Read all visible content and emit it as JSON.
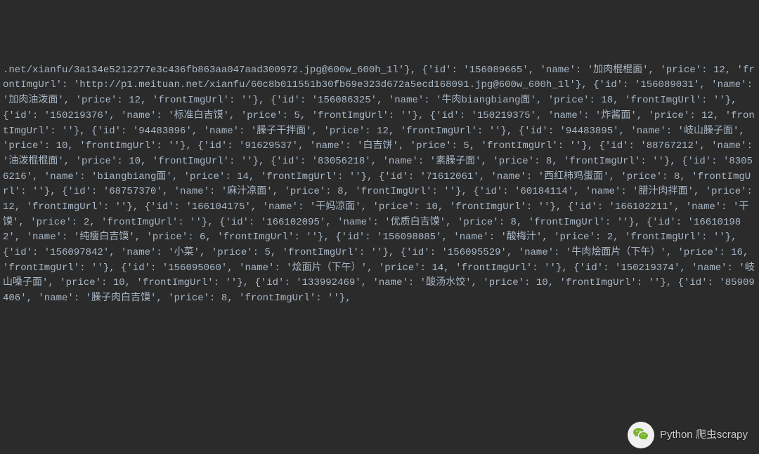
{
  "watermark": {
    "text": "Python 爬虫scrapy"
  },
  "console_text": ".net/xianfu/3a134e5212277e3c436fb863aa047aad300972.jpg@600w_600h_1l'}, {'id': '156089665', 'name': '加肉棍棍面', 'price': 12, 'frontImgUrl': 'http://p1.meituan.net/xianfu/60c8b011551b30fb69e323d672a5ecd168091.jpg@600w_600h_1l'}, {'id': '156089031', 'name': '加肉油泼面', 'price': 12, 'frontImgUrl': ''}, {'id': '156086325', 'name': '牛肉biangbiang面', 'price': 18, 'frontImgUrl': ''}, {'id': '150219376', 'name': '标准白吉馍', 'price': 5, 'frontImgUrl': ''}, {'id': '150219375', 'name': '炸酱面', 'price': 12, 'frontImgUrl': ''}, {'id': '94483896', 'name': '臊子干拌面', 'price': 12, 'frontImgUrl': ''}, {'id': '94483895', 'name': '岐山臊子面', 'price': 10, 'frontImgUrl': ''}, {'id': '91629537', 'name': '白吉饼', 'price': 5, 'frontImgUrl': ''}, {'id': '88767212', 'name': '油泼棍棍面', 'price': 10, 'frontImgUrl': ''}, {'id': '83056218', 'name': '素臊子面', 'price': 8, 'frontImgUrl': ''}, {'id': '83056216', 'name': 'biangbiang面', 'price': 14, 'frontImgUrl': ''}, {'id': '71612061', 'name': '西红柿鸡蛋面', 'price': 8, 'frontImgUrl': ''}, {'id': '68757370', 'name': '麻汁凉面', 'price': 8, 'frontImgUrl': ''}, {'id': '60184114', 'name': '腊汁肉拌面', 'price': 12, 'frontImgUrl': ''}, {'id': '166104175', 'name': '干妈凉面', 'price': 10, 'frontImgUrl': ''}, {'id': '166102211', 'name': '干馍', 'price': 2, 'frontImgUrl': ''}, {'id': '166102095', 'name': '优质白吉馍', 'price': 8, 'frontImgUrl': ''}, {'id': '166101982', 'name': '纯瘦白吉馍', 'price': 6, 'frontImgUrl': ''}, {'id': '156098085', 'name': '酸梅汁', 'price': 2, 'frontImgUrl': ''}, {'id': '156097842', 'name': '小菜', 'price': 5, 'frontImgUrl': ''}, {'id': '156095529', 'name': '牛肉烩面片（下午）', 'price': 16, 'frontImgUrl': ''}, {'id': '156095060', 'name': '烩面片（下午）', 'price': 14, 'frontImgUrl': ''}, {'id': '150219374', 'name': '岐山嗓子面', 'price': 10, 'frontImgUrl': ''}, {'id': '133992469', 'name': '酸汤水饺', 'price': 10, 'frontImgUrl': ''}, {'id': '85909406', 'name': '臊子肉白吉馍', 'price': 8, 'frontImgUrl': ''},",
  "items": [
    {
      "id": "156089665",
      "name": "加肉棍棍面",
      "price": 12,
      "frontImgUrl": "http://p1.meituan.net/xianfu/60c8b011551b30fb69e323d672a5ecd168091.jpg@600w_600h_1l"
    },
    {
      "id": "156089031",
      "name": "加肉油泼面",
      "price": 12,
      "frontImgUrl": ""
    },
    {
      "id": "156086325",
      "name": "牛肉biangbiang面",
      "price": 18,
      "frontImgUrl": ""
    },
    {
      "id": "150219376",
      "name": "标准白吉馍",
      "price": 5,
      "frontImgUrl": ""
    },
    {
      "id": "150219375",
      "name": "炸酱面",
      "price": 12,
      "frontImgUrl": ""
    },
    {
      "id": "94483896",
      "name": "臊子干拌面",
      "price": 12,
      "frontImgUrl": ""
    },
    {
      "id": "94483895",
      "name": "岐山臊子面",
      "price": 10,
      "frontImgUrl": ""
    },
    {
      "id": "91629537",
      "name": "白吉饼",
      "price": 5,
      "frontImgUrl": ""
    },
    {
      "id": "88767212",
      "name": "油泼棍棍面",
      "price": 10,
      "frontImgUrl": ""
    },
    {
      "id": "83056218",
      "name": "素臊子面",
      "price": 8,
      "frontImgUrl": ""
    },
    {
      "id": "83056216",
      "name": "biangbiang面",
      "price": 14,
      "frontImgUrl": ""
    },
    {
      "id": "71612061",
      "name": "西红柿鸡蛋面",
      "price": 8,
      "frontImgUrl": ""
    },
    {
      "id": "68757370",
      "name": "麻汁凉面",
      "price": 8,
      "frontImgUrl": ""
    },
    {
      "id": "60184114",
      "name": "腊汁肉拌面",
      "price": 12,
      "frontImgUrl": ""
    },
    {
      "id": "166104175",
      "name": "干妈凉面",
      "price": 10,
      "frontImgUrl": ""
    },
    {
      "id": "166102211",
      "name": "干馍",
      "price": 2,
      "frontImgUrl": ""
    },
    {
      "id": "166102095",
      "name": "优质白吉馍",
      "price": 8,
      "frontImgUrl": ""
    },
    {
      "id": "166101982",
      "name": "纯瘦白吉馍",
      "price": 6,
      "frontImgUrl": ""
    },
    {
      "id": "156098085",
      "name": "酸梅汁",
      "price": 2,
      "frontImgUrl": ""
    },
    {
      "id": "156097842",
      "name": "小菜",
      "price": 5,
      "frontImgUrl": ""
    },
    {
      "id": "156095529",
      "name": "牛肉烩面片（下午）",
      "price": 16,
      "frontImgUrl": ""
    },
    {
      "id": "156095060",
      "name": "烩面片（下午）",
      "price": 14,
      "frontImgUrl": ""
    },
    {
      "id": "150219374",
      "name": "岐山嗓子面",
      "price": 10,
      "frontImgUrl": ""
    },
    {
      "id": "133992469",
      "name": "酸汤水饺",
      "price": 10,
      "frontImgUrl": ""
    },
    {
      "id": "85909406",
      "name": "臊子肉白吉馍",
      "price": 8,
      "frontImgUrl": ""
    }
  ]
}
